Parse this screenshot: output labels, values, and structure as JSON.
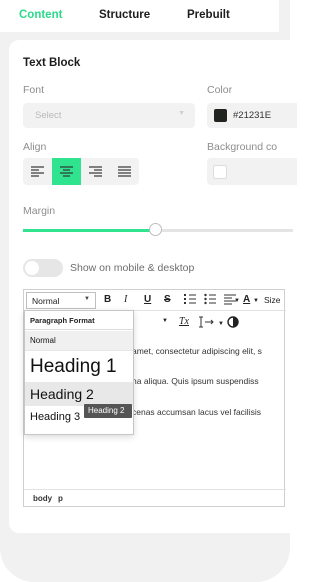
{
  "tabs": {
    "content": "Content",
    "structure": "Structure",
    "prebuilt": "Prebuilt"
  },
  "colors": {
    "accent": "#2bd98a",
    "color_swatch": "#21231E"
  },
  "panel": {
    "title": "Text Block",
    "font_label": "Font",
    "font_placeholder": "Select",
    "color_label": "Color",
    "color_value": "#21231E",
    "align_label": "Align",
    "align_selected": "center",
    "background_label": "Background co",
    "margin_label": "Margin",
    "margin_fraction": 0.49,
    "toggle_label": "Show on mobile & desktop",
    "toggle_on": false
  },
  "editor": {
    "format_value": "Normal",
    "toolbar": {
      "bold": "B",
      "italic": "I",
      "underline": "U",
      "strike": "S",
      "text_color": "A",
      "size_label": "Size",
      "clear_format": "Tx"
    },
    "lines": [
      "amet, consectetur adipiscing elit, s",
      "na aliqua. Quis ipsum suspendiss",
      "cenas accumsan lacus vel facilisis"
    ],
    "path": [
      "body",
      "p"
    ]
  },
  "dropdown": {
    "header": "Paragraph Format",
    "items": [
      "Normal",
      "Heading 1",
      "Heading 2",
      "Heading 3"
    ],
    "tooltip": "Heading 2"
  }
}
